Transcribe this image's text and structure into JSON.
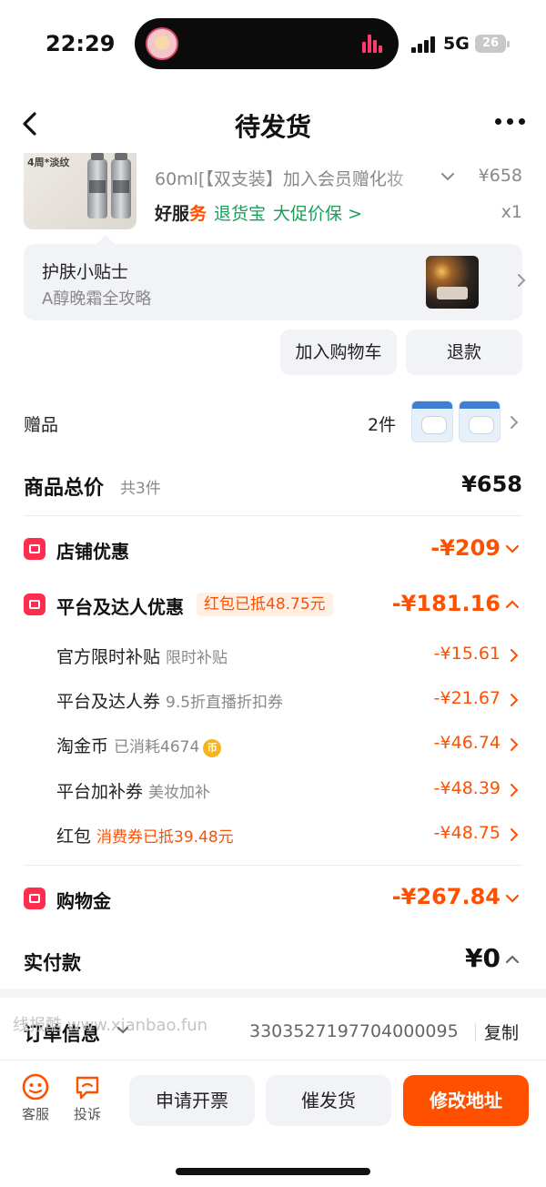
{
  "status": {
    "time": "22:29",
    "network": "5G",
    "battery": "26"
  },
  "nav": {
    "title": "待发货"
  },
  "product": {
    "image_tag": "4周*淡纹",
    "name": "60ml[【双支装】加入会员赠化妆",
    "price": "¥658",
    "qty": "x1",
    "service_good_a": "好服",
    "service_good_b": "务",
    "service_return": "退货宝",
    "service_promo": "大促价保 >"
  },
  "tips": {
    "title": "护肤小贴士",
    "subtitle": "A醇晚霜全攻略"
  },
  "actions": {
    "add_cart": "加入购物车",
    "refund": "退款"
  },
  "gift": {
    "label": "赠品",
    "count": "2件"
  },
  "total": {
    "label": "商品总价",
    "count": "共3件",
    "value": "¥658"
  },
  "discounts": {
    "store": {
      "label": "店铺优惠",
      "value": "-¥209"
    },
    "platform": {
      "label": "平台及达人优惠",
      "pill": "红包已抵48.75元",
      "value": "-¥181.16",
      "items": [
        {
          "label": "官方限时补贴",
          "note": "限时补贴",
          "value": "-¥15.61"
        },
        {
          "label": "平台及达人券",
          "note": "9.5折直播折扣券",
          "value": "-¥21.67"
        },
        {
          "label": "淘金币",
          "note": "已消耗4674",
          "coin": "币",
          "value": "-¥46.74"
        },
        {
          "label": "平台加补券",
          "note": "美妆加补",
          "value": "-¥48.39"
        },
        {
          "label": "红包",
          "note": "消费券已抵39.48元",
          "value": "-¥48.75"
        }
      ]
    },
    "shopping_gold": {
      "label": "购物金",
      "value": "-¥267.84"
    }
  },
  "payment": {
    "label": "实付款",
    "value": "¥0"
  },
  "order": {
    "label": "订单信息",
    "number": "3303527197704000095",
    "copy": "复制",
    "watermark": "线报酷 www.xianbao.fun"
  },
  "bottom": {
    "service": "客服",
    "complaint": "投诉",
    "invoice": "申请开票",
    "urge": "催发货",
    "address": "修改地址"
  },
  "colors": {
    "accent": "#ff5000",
    "discount_icon": "#ff2d4d",
    "green": "#18a058"
  }
}
